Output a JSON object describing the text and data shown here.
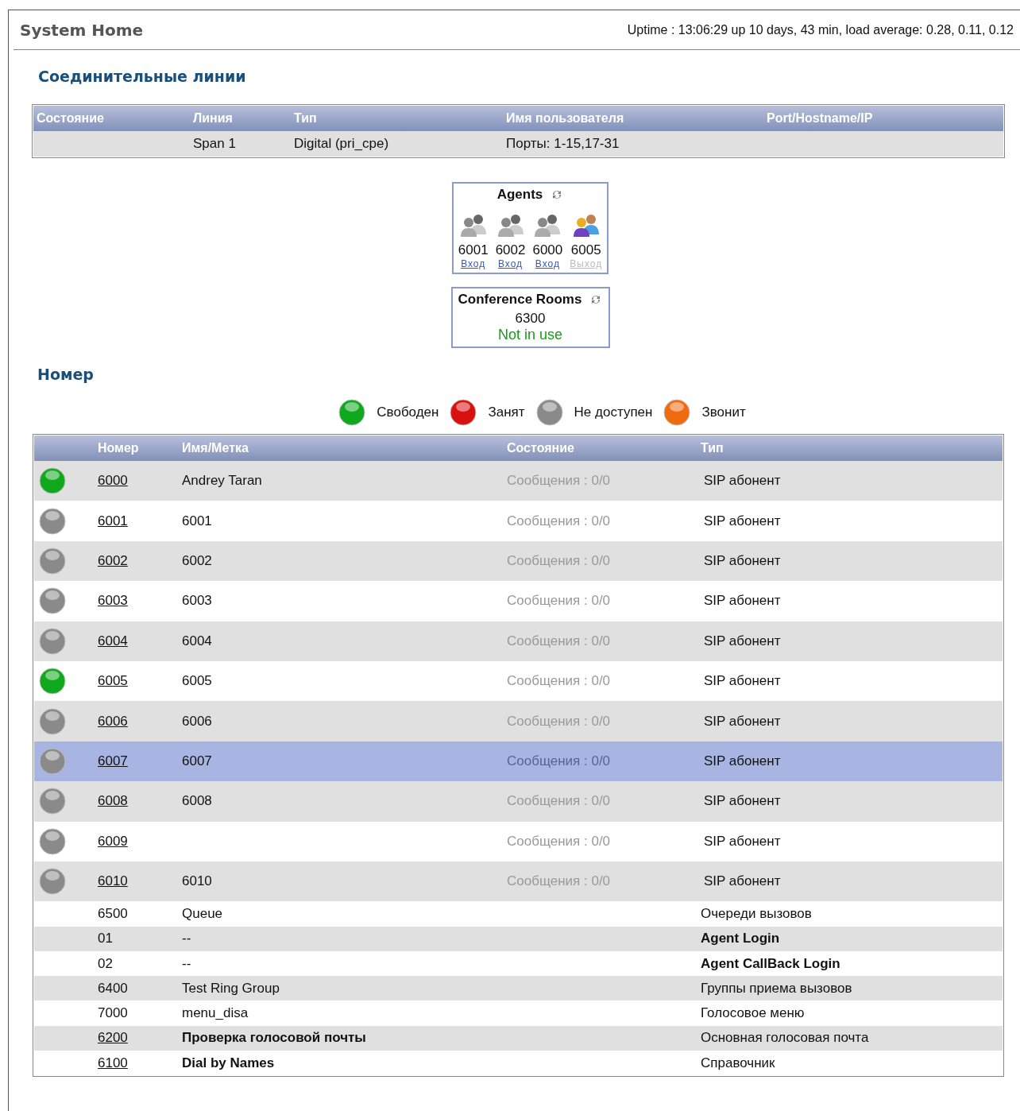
{
  "header": {
    "title": "System Home",
    "uptime": "Uptime : 13:06:29 up 10 days, 43 min, load average: 0.28, 0.11, 0.12"
  },
  "trunks": {
    "heading": "Соединительные линии",
    "columns": [
      "Состояние",
      "Линия",
      "Тип",
      "Имя пользователя",
      "Port/Hostname/IP"
    ],
    "rows": [
      {
        "state": "",
        "line": "Span 1",
        "type": "Digital (pri_cpe)",
        "user": "Порты: 1-15,17-31",
        "port": ""
      }
    ]
  },
  "agents": {
    "title": "Agents",
    "items": [
      {
        "number": "6001",
        "action": "Вход",
        "active": false
      },
      {
        "number": "6002",
        "action": "Вход",
        "active": false
      },
      {
        "number": "6000",
        "action": "Вход",
        "active": false
      },
      {
        "number": "6005",
        "action": "Выход",
        "active": true
      }
    ]
  },
  "conference": {
    "title": "Conference Rooms",
    "number": "6300",
    "status": "Not in use"
  },
  "extensions": {
    "heading": "Номер",
    "legend": [
      {
        "label": "Свободен",
        "color": "#10a81c"
      },
      {
        "label": "Занят",
        "color": "#d81010"
      },
      {
        "label": "Не доступен",
        "color": "#8a8a8a"
      },
      {
        "label": "Звонит",
        "color": "#f06a10"
      }
    ],
    "columns": [
      "Номер",
      "Имя/Метка",
      "Состояние",
      "Тип"
    ],
    "rows": [
      {
        "kind": "phone",
        "color": "#10a81c",
        "number": "6000",
        "name": "Andrey Taran",
        "state": "Сообщения : 0/0",
        "type": "SIP абонент",
        "selected": false
      },
      {
        "kind": "phone",
        "color": "#8a8a8a",
        "number": "6001",
        "name": "6001",
        "state": "Сообщения : 0/0",
        "type": "SIP абонент",
        "selected": false
      },
      {
        "kind": "phone",
        "color": "#8a8a8a",
        "number": "6002",
        "name": "6002",
        "state": "Сообщения : 0/0",
        "type": "SIP абонент",
        "selected": false
      },
      {
        "kind": "phone",
        "color": "#8a8a8a",
        "number": "6003",
        "name": "6003",
        "state": "Сообщения : 0/0",
        "type": "SIP абонент",
        "selected": false
      },
      {
        "kind": "phone",
        "color": "#8a8a8a",
        "number": "6004",
        "name": "6004",
        "state": "Сообщения : 0/0",
        "type": "SIP абонент",
        "selected": false
      },
      {
        "kind": "phone",
        "color": "#10a81c",
        "number": "6005",
        "name": "6005",
        "state": "Сообщения : 0/0",
        "type": "SIP абонент",
        "selected": false
      },
      {
        "kind": "phone",
        "color": "#8a8a8a",
        "number": "6006",
        "name": "6006",
        "state": "Сообщения : 0/0",
        "type": "SIP абонент",
        "selected": false
      },
      {
        "kind": "phone",
        "color": "#8a8a8a",
        "number": "6007",
        "name": "6007",
        "state": "Сообщения : 0/0",
        "type": "SIP абонент",
        "selected": true
      },
      {
        "kind": "phone",
        "color": "#8a8a8a",
        "number": "6008",
        "name": "6008",
        "state": "Сообщения : 0/0",
        "type": "SIP абонент",
        "selected": false
      },
      {
        "kind": "phone",
        "color": "#8a8a8a",
        "number": "6009",
        "name": "",
        "state": "Сообщения : 0/0",
        "type": "SIP абонент",
        "selected": false
      },
      {
        "kind": "phone",
        "color": "#8a8a8a",
        "number": "6010",
        "name": "6010",
        "state": "Сообщения : 0/0",
        "type": "SIP абонент",
        "selected": false
      },
      {
        "kind": "service",
        "number": "6500",
        "name": "Queue",
        "type": "Очереди вызовов",
        "link": false,
        "bold_name": false,
        "bold_type": false
      },
      {
        "kind": "service",
        "number": "01",
        "name": "--",
        "type": "Agent Login",
        "link": false,
        "bold_name": false,
        "bold_type": true
      },
      {
        "kind": "service",
        "number": "02",
        "name": "--",
        "type": "Agent CallBack Login",
        "link": false,
        "bold_name": false,
        "bold_type": true
      },
      {
        "kind": "service",
        "number": "6400",
        "name": "Test Ring Group",
        "type": "Группы приема вызовов",
        "link": false,
        "bold_name": false,
        "bold_type": false
      },
      {
        "kind": "service",
        "number": "7000",
        "name": "menu_disa",
        "type": "Голосовое меню",
        "link": false,
        "bold_name": false,
        "bold_type": false
      },
      {
        "kind": "service",
        "number": "6200",
        "name": "Проверка голосовой почты",
        "type": "Основная голосовая почта",
        "link": true,
        "bold_name": true,
        "bold_type": false
      },
      {
        "kind": "service",
        "number": "6100",
        "name": "Dial by Names",
        "type": "Справочник",
        "link": true,
        "bold_name": true,
        "bold_type": false
      }
    ]
  }
}
